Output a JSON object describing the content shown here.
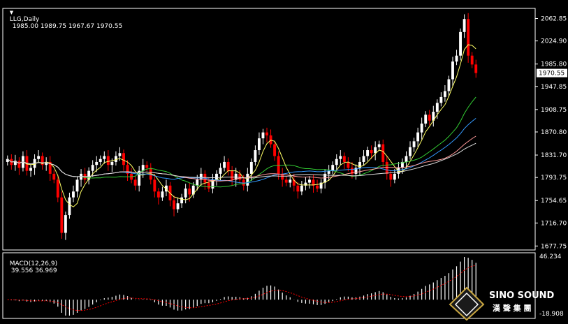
{
  "header": {
    "symbol_label": "LLG,Daily",
    "ohlc": "1985.00 1989.75 1967.67 1970.55"
  },
  "macd": {
    "label": "MACD(12,26,9)",
    "values": "39.556 36.969",
    "axis_ticks": [
      "46.234",
      "-18.908"
    ]
  },
  "price_axis": {
    "ticks": [
      "2062.85",
      "2024.90",
      "1985.80",
      "1947.85",
      "1908.75",
      "1870.80",
      "1831.70",
      "1793.75",
      "1754.65",
      "1716.70",
      "1677.75"
    ],
    "current_price": "1970.55"
  },
  "logo": {
    "brand": "SINO SOUND",
    "chinese": "漢 聲 集 團"
  },
  "colors": {
    "background": "#000000",
    "up_candle": "#ffffff",
    "down_candle": "#ff0000",
    "ma_fast": "#ffff66",
    "ma_green": "#33cc33",
    "ma_blue": "#3399ff",
    "ma_salmon": "#ff9999",
    "ma_white": "#dddddd",
    "macd_signal": "#ff0000",
    "grid_frame": "#ffffff"
  },
  "chart_data": {
    "type": "candlestick",
    "symbol": "LLG",
    "timeframe": "Daily",
    "ylim": [
      1677.75,
      2080
    ],
    "last": {
      "open": 1985.0,
      "high": 1989.75,
      "low": 1967.67,
      "close": 1970.55
    },
    "closes": [
      1825,
      1815,
      1822,
      1810,
      1830,
      1805,
      1810,
      1825,
      1830,
      1815,
      1820,
      1800,
      1790,
      1760,
      1700,
      1730,
      1760,
      1770,
      1790,
      1800,
      1790,
      1805,
      1815,
      1820,
      1825,
      1830,
      1815,
      1820,
      1830,
      1835,
      1815,
      1800,
      1790,
      1780,
      1805,
      1815,
      1810,
      1790,
      1770,
      1760,
      1770,
      1780,
      1755,
      1740,
      1750,
      1760,
      1775,
      1765,
      1780,
      1790,
      1800,
      1785,
      1775,
      1790,
      1800,
      1810,
      1820,
      1805,
      1790,
      1800,
      1790,
      1780,
      1800,
      1820,
      1840,
      1860,
      1870,
      1865,
      1850,
      1830,
      1800,
      1790,
      1785,
      1790,
      1780,
      1770,
      1780,
      1785,
      1790,
      1780,
      1775,
      1785,
      1800,
      1805,
      1815,
      1825,
      1830,
      1820,
      1810,
      1800,
      1810,
      1820,
      1830,
      1840,
      1835,
      1845,
      1850,
      1820,
      1800,
      1790,
      1800,
      1810,
      1820,
      1830,
      1845,
      1855,
      1870,
      1885,
      1900,
      1890,
      1905,
      1920,
      1930,
      1940,
      1960,
      1990,
      2000,
      2040,
      2062,
      2000,
      1985,
      1970.55
    ],
    "macd_line_peak": 46.234,
    "macd_axis_min": -18.908,
    "macd_current": 39.556,
    "signal_current": 36.969
  }
}
